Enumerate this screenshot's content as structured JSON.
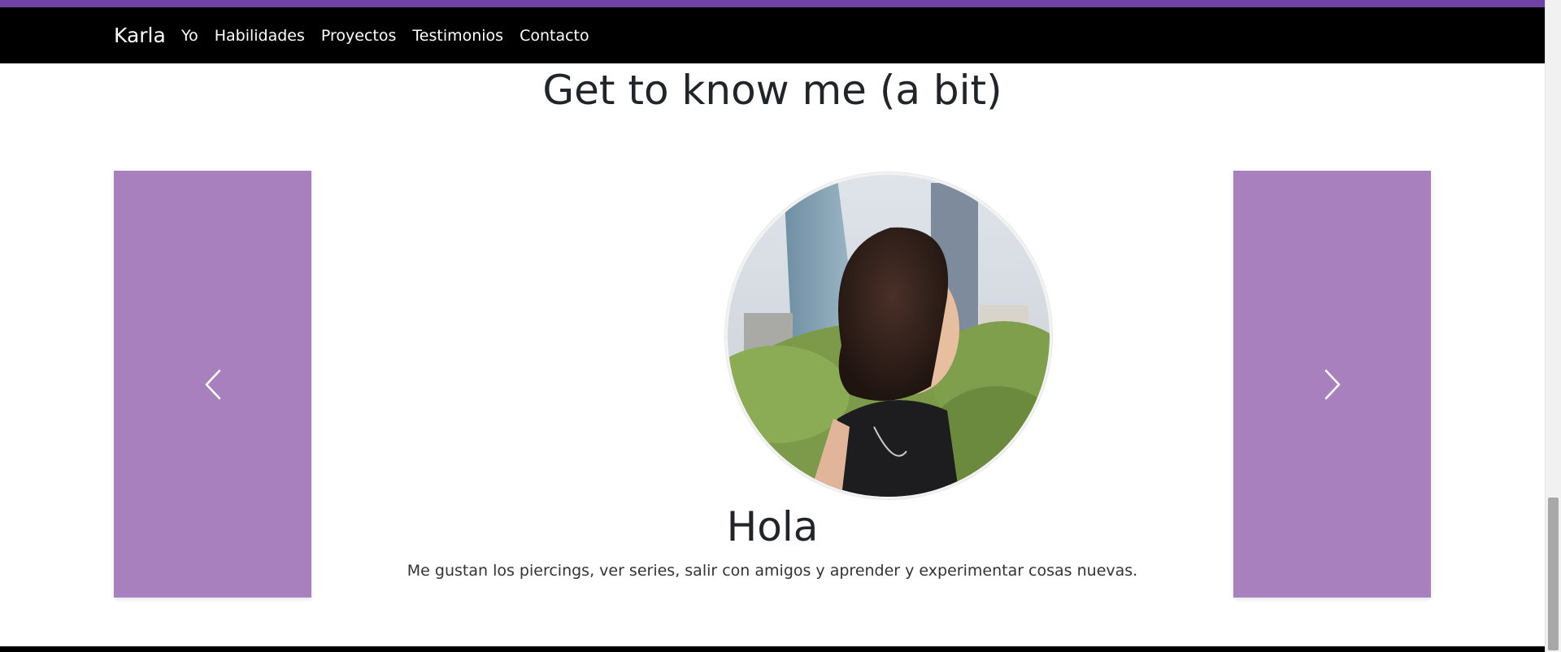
{
  "navbar": {
    "brand": "Karla",
    "links": [
      "Yo",
      "Habilidades",
      "Proyectos",
      "Testimonios",
      "Contacto"
    ],
    "background": "#000000"
  },
  "accent_color": "#6f42a8",
  "section": {
    "title": "Get to know me (a bit)"
  },
  "carousel": {
    "control_color": "#a880be",
    "prev_icon": "chevron-left-icon",
    "next_icon": "chevron-right-icon",
    "slide": {
      "title": "Hola",
      "text": "Me gustan los piercings, ver series, salir con amigos y aprender y experimentar cosas nuevas.",
      "image": "portrait-photo"
    }
  }
}
